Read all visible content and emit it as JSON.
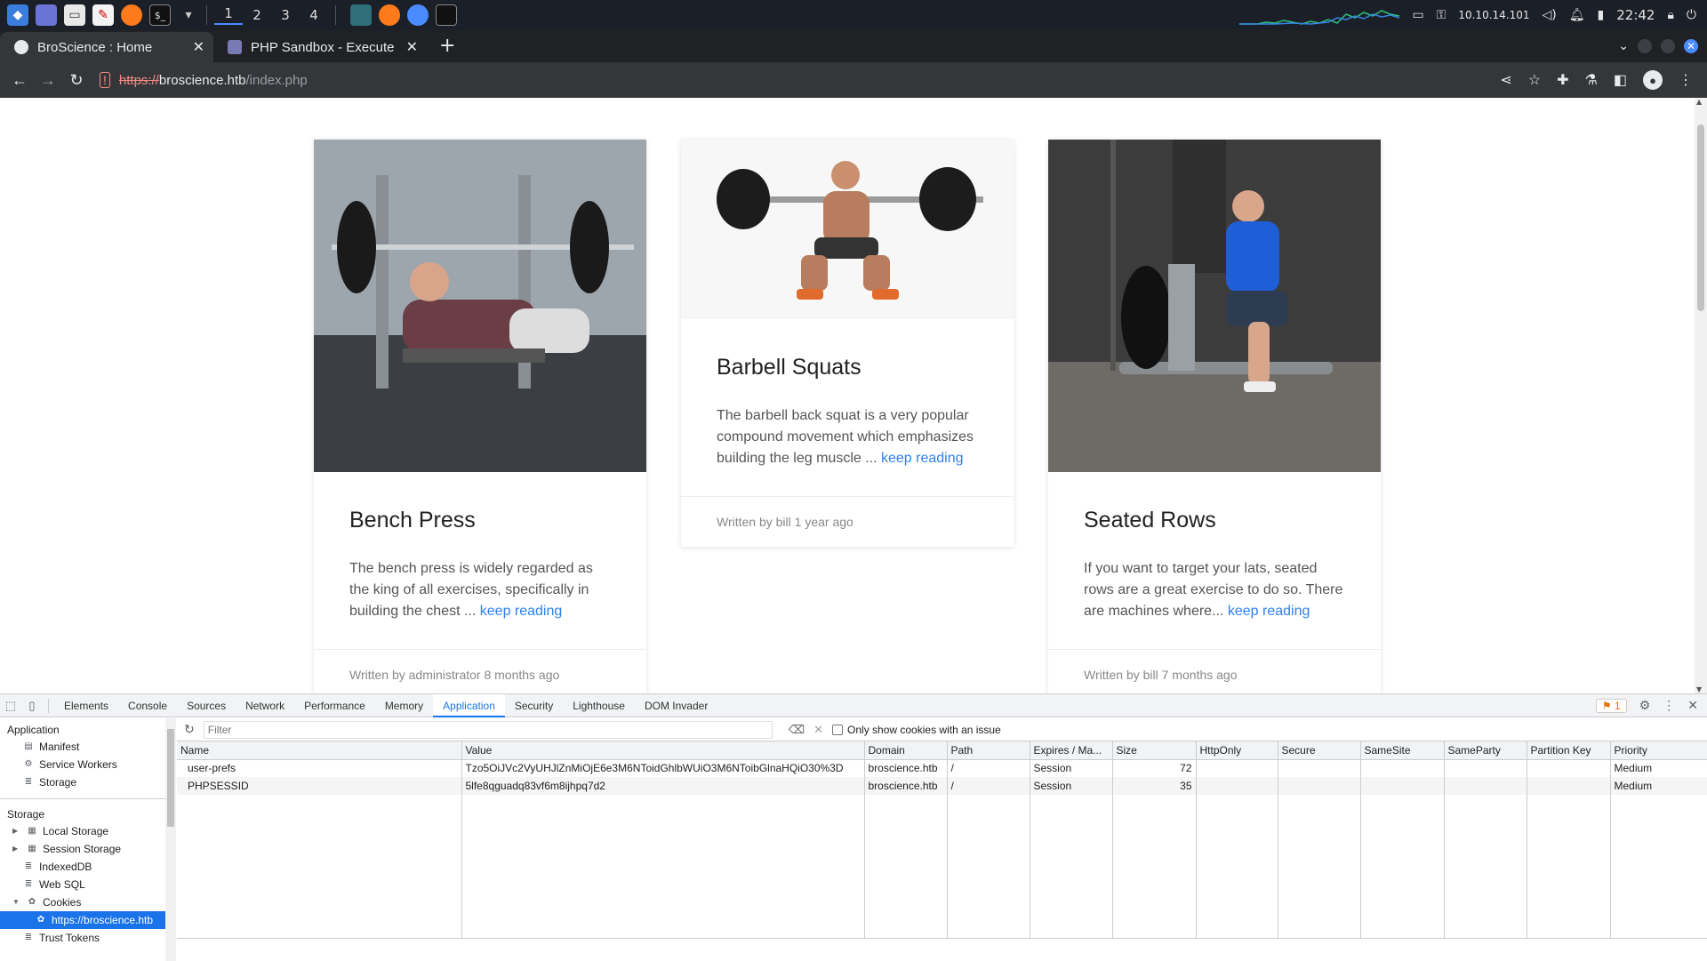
{
  "taskbar": {
    "workspaces": [
      "1",
      "2",
      "3",
      "4"
    ],
    "ip": "10.10.14.101",
    "time": "22:42"
  },
  "browser": {
    "tabs": [
      {
        "title": "BroScience : Home",
        "active": true
      },
      {
        "title": "PHP Sandbox - Execute PH",
        "active": false
      }
    ],
    "url": {
      "scheme": "https://",
      "host": "broscience.htb",
      "path": "/index.php"
    }
  },
  "cards": [
    {
      "title": "Bench Press",
      "excerpt": "The bench press is widely regarded as the king of all exercises, specifically in building the chest ...",
      "link": "keep reading",
      "footer": "Written by administrator 8 months ago"
    },
    {
      "title": "Barbell Squats",
      "excerpt": "The barbell back squat is a very popular compound movement which emphasizes building the leg muscle ...",
      "link": "keep reading",
      "footer": "Written by bill 1 year ago"
    },
    {
      "title": "Seated Rows",
      "excerpt": "If you want to target your lats, seated rows are a great exercise to do so. There are machines where...",
      "link": "keep reading",
      "footer": "Written by bill 7 months ago"
    }
  ],
  "devtools": {
    "tabs": [
      "Elements",
      "Console",
      "Sources",
      "Network",
      "Performance",
      "Memory",
      "Application",
      "Security",
      "Lighthouse",
      "DOM Invader"
    ],
    "active_tab": "Application",
    "issues_count": "1",
    "sidebar": {
      "application_header": "Application",
      "application_items": [
        "Manifest",
        "Service Workers",
        "Storage"
      ],
      "storage_header": "Storage",
      "storage_items": [
        "Local Storage",
        "Session Storage",
        "IndexedDB",
        "Web SQL",
        "Cookies"
      ],
      "cookie_origin": "https://broscience.htb",
      "last_item": "Trust Tokens"
    },
    "filter": {
      "placeholder": "Filter",
      "issue_label": "Only show cookies with an issue"
    },
    "columns": [
      "Name",
      "Value",
      "Domain",
      "Path",
      "Expires / Ma...",
      "Size",
      "HttpOnly",
      "Secure",
      "SameSite",
      "SameParty",
      "Partition Key",
      "Priority"
    ],
    "rows": [
      [
        "user-prefs",
        "Tzo5OiJVc2VyUHJlZnMiOjE6e3M6NToidGhlbWUiO3M6NToibGlnaHQiO30%3D",
        "broscience.htb",
        "/",
        "Session",
        "72",
        "",
        "",
        "",
        "",
        "",
        "Medium"
      ],
      [
        "PHPSESSID",
        "5lfe8qguadq83vf6m8ijhpq7d2",
        "broscience.htb",
        "/",
        "Session",
        "35",
        "",
        "",
        "",
        "",
        "",
        "Medium"
      ]
    ]
  },
  "colors": {
    "accent": "#1a73e8",
    "link": "#2f80ed",
    "taskbar": "#1b1f27"
  }
}
